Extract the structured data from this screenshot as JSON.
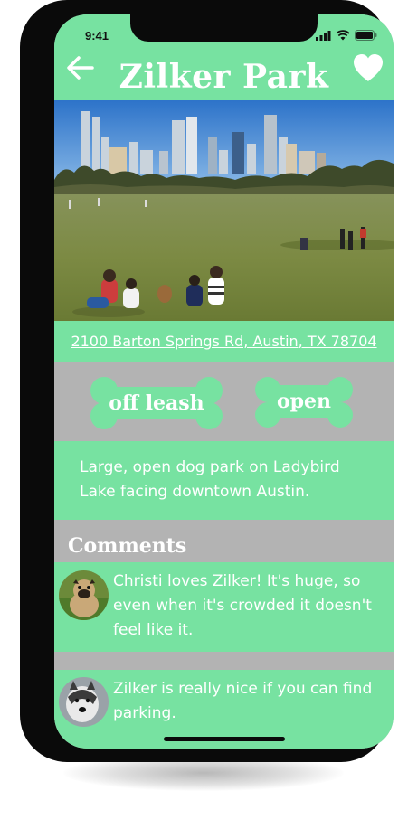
{
  "status_bar": {
    "time": "9:41"
  },
  "header": {
    "title": "Zilker Park"
  },
  "address": "2100 Barton Springs Rd, Austin, TX 78704",
  "tags": [
    {
      "label": "off leash"
    },
    {
      "label": "open"
    }
  ],
  "description": "Large, open dog park on Ladybird Lake facing downtown Austin.",
  "comments": {
    "title": "Comments",
    "items": [
      {
        "text": "Christi loves Zilker! It's huge, so even when it's crowded it doesn't feel like it.",
        "avatar": "pug-avatar"
      },
      {
        "text": "Zilker is really nice if you can find parking.",
        "avatar": "husky-avatar"
      }
    ]
  },
  "colors": {
    "accent_green": "#77e2a1",
    "background_gray": "#b3b3b3",
    "text_white": "#ffffff",
    "phone_frame": "#0a0a0a"
  }
}
